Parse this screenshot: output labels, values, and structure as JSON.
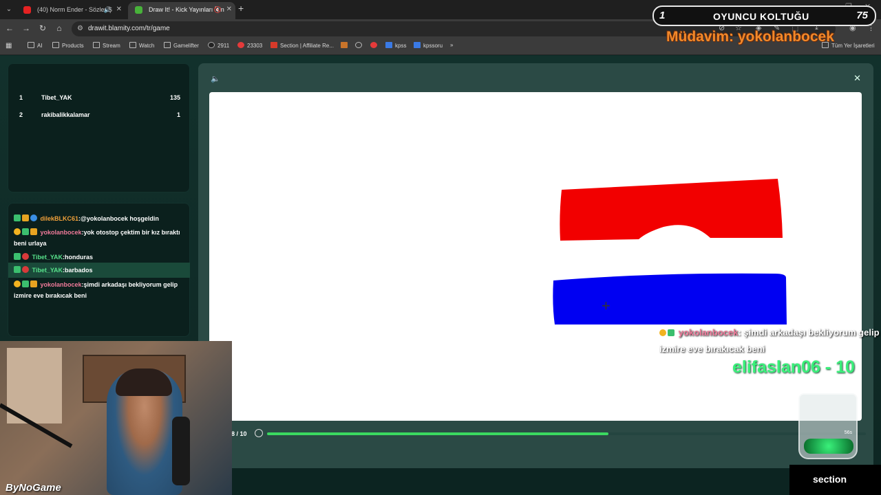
{
  "browser": {
    "tabs": [
      {
        "title": "(40) Norm Ender - Sözler Ş"
      },
      {
        "title": "Draw It! - Kick Yayınları İçin"
      }
    ],
    "url": "drawit.blamity.com/tr/game",
    "bookmarks": [
      "AI",
      "Products",
      "Stream",
      "Watch",
      "Gamelifter",
      "2911",
      "23303",
      "Section | Affiliate Re...",
      "kpss",
      "kpssoru"
    ],
    "all_bookmarks_label": "Tüm Yer İşaretleri"
  },
  "leaderboard": [
    {
      "rank": "1",
      "name": "Tibet_YAK",
      "score": "135"
    },
    {
      "rank": "2",
      "name": "rakibalikkalamar",
      "score": "1"
    }
  ],
  "chat": [
    {
      "user": "dilekBLKC61",
      "text": ":@yokolanbocek hoşgeldin",
      "color": "#f0a03a"
    },
    {
      "user": "yokolanbocek",
      "text": ":yok otostop çektim bir kız bıraktı beni urlaya",
      "color": "#f07a9a"
    },
    {
      "user": "Tibet_YAK",
      "text": ":honduras",
      "color": "#57e08a"
    },
    {
      "user": "Tibet_YAK",
      "text": ":barbados",
      "color": "#57e08a"
    },
    {
      "user": "yokolanbocek",
      "text": ":şimdi arkadaşı bekliyorum gelip izmire eve bırakıcak beni",
      "color": "#f07a9a"
    }
  ],
  "game": {
    "round_label": "8 / 10",
    "progress": 0.57,
    "canvas_colors": {
      "red": "#f20000",
      "blue": "#0000f2"
    }
  },
  "overlay": {
    "seat_rank": "1",
    "seat_title": "OYUNCU KOLTUĞU",
    "seat_score": "75",
    "mudavim": "Müdavim: yokolanbocek",
    "chat_user": "yokolanbocek",
    "chat_text": ": şimdi arkadaşı bekliyorum gelip izmire eve bırakıcak beni",
    "donation": "elifaslan06 - 10",
    "jar_label": "56s",
    "streamer_brand": "ByNoGame",
    "sponsor": "section"
  }
}
